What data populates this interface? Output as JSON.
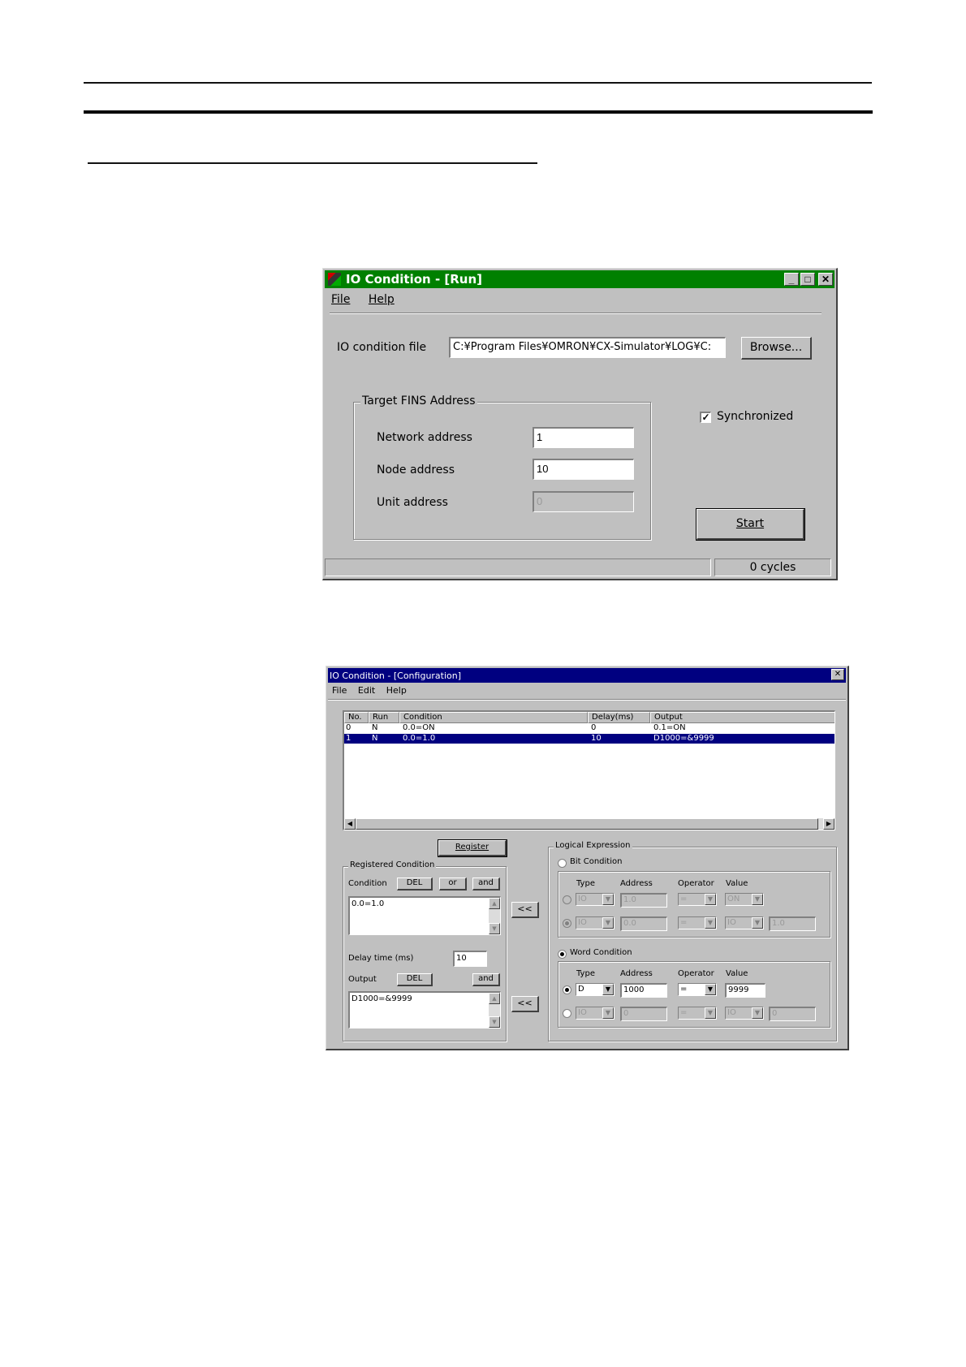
{
  "window1": {
    "title": "IO Condition - [Run]",
    "menu": [
      "File",
      "Help"
    ],
    "io_file_label": "IO condition file",
    "io_file_value": "C:¥Program Files¥OMRON¥CX-Simulator¥LOG¥C:",
    "browse_label": "Browse...",
    "group_title": "Target FINS Address",
    "network_label": "Network address",
    "network_value": "1",
    "node_label": "Node address",
    "node_value": "10",
    "unit_label": "Unit address",
    "unit_value": "0",
    "synchronized_label": "Synchronized",
    "synchronized_checked": true,
    "start_label": "Start",
    "status_left": "",
    "status_right": "0 cycles",
    "title_color": "#008000"
  },
  "window2": {
    "title": "IO Condition - [Configuration]",
    "menu": [
      "File",
      "Edit",
      "Help"
    ],
    "title_color": "#000080",
    "table": {
      "columns": [
        "No.",
        "Run",
        "Condition",
        "Delay(ms)",
        "Output"
      ],
      "rows": [
        {
          "no": "0",
          "run": "N",
          "condition": "0.0=ON",
          "delay": "0",
          "output": "0.1=ON",
          "selected": false
        },
        {
          "no": "1",
          "run": "N",
          "condition": "0.0=1.0",
          "delay": "10",
          "output": "D1000=&9999",
          "selected": true
        }
      ]
    },
    "register_label": "Register",
    "registered_group": "Registered Condition",
    "condition_label": "Condition",
    "del_label": "DEL",
    "or_label": "or",
    "and_label": "and",
    "condition_text": "0.0=1.0",
    "delay_label": "Delay time (ms)",
    "delay_value": "10",
    "output_label": "Output",
    "output_text": "D1000=&9999",
    "transfer_label": "<<",
    "logical_group": "Logical Expression",
    "bit_condition_label": "Bit Condition",
    "word_condition_label": "Word Condition",
    "col_type": "Type",
    "col_address": "Address",
    "col_operator": "Operator",
    "col_value": "Value",
    "bit_row1": {
      "type": "IO",
      "address": "1.0",
      "operator": "=",
      "value": "ON"
    },
    "bit_row2": {
      "type": "IO",
      "address": "0.0",
      "operator": "=",
      "value": "IO",
      "value2": "1.0"
    },
    "word_row1": {
      "type": "D",
      "address": "1000",
      "operator": "=",
      "value": "9999"
    },
    "word_row2": {
      "type": "IO",
      "address": "0",
      "operator": "=",
      "value": "IO",
      "value2": "0"
    }
  }
}
